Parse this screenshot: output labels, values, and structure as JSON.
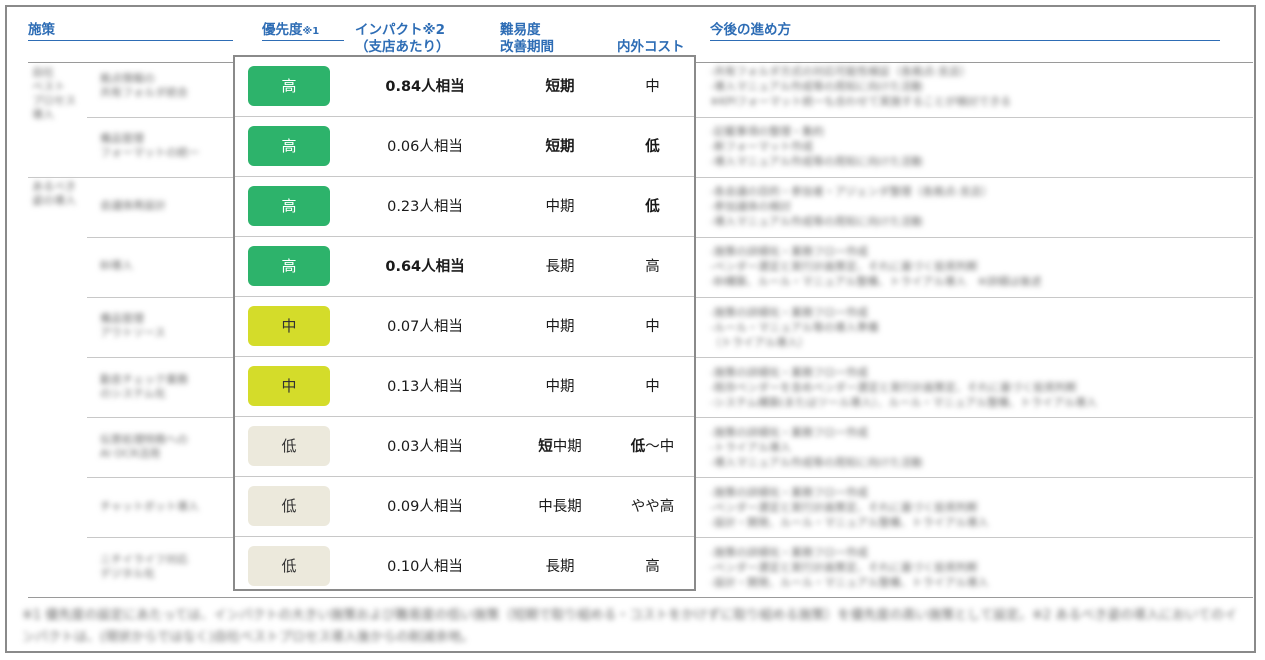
{
  "headers": {
    "measure": "施策",
    "priority": "優先度",
    "priority_note": "※1",
    "impact": "インパクト",
    "impact_note": "※2",
    "impact_sub": "（支店あたり）",
    "difficulty": "難易度",
    "period": "改善期間",
    "cost": "内外コスト",
    "next_steps": "今後の進め方"
  },
  "colors": {
    "header_blue": "#2e6db5",
    "high": "#2db36b",
    "mid": "#d4dc2a",
    "low": "#ece9dc"
  },
  "groups": [
    {
      "label": "自社\nベスト\nプロセス\n導入"
    },
    {
      "label": "あるべき\n姿の導入"
    }
  ],
  "rows": [
    {
      "name": "拠点情報の\n共有フォルダ統合",
      "priority": "高",
      "level": "high",
      "impact": "0.84人相当",
      "impact_bold": true,
      "period": "短期",
      "period_bold_part": "短期",
      "cost": "中",
      "cost_bold": false,
      "desc": "-共有フォルダ方式の対応可能性検証（各拠点-支店）\n-導入マニュアル作成等の周知に向けた活動\n※KPIフォーマット統一も合わせて実施することが検討できる"
    },
    {
      "name": "備品管理\nフォーマットの統一",
      "priority": "高",
      "level": "high",
      "impact": "0.06人相当",
      "impact_bold": false,
      "period": "短期",
      "period_bold_part": "短期",
      "cost": "低",
      "cost_bold": true,
      "desc": "-記載事項の整理・集約\n-新フォーマット作成\n-導入マニュアル作成等の周知に向けた活動"
    },
    {
      "name": "会議体再設計",
      "priority": "高",
      "level": "high",
      "impact": "0.23人相当",
      "impact_bold": false,
      "period": "中期",
      "period_bold_part": "",
      "cost": "低",
      "cost_bold": true,
      "desc": "-各会議の目的・参加者・アジェンダ整理（各拠点-支店）\n-参加議体の検討\n-導入マニュアル作成等の周知に向けた活動"
    },
    {
      "name": "BI導入",
      "priority": "高",
      "level": "high",
      "impact": "0.64人相当",
      "impact_bold": true,
      "period": "長期",
      "period_bold_part": "",
      "cost": "高",
      "cost_bold": false,
      "desc": "-施策の詳細化・業務フロー作成\n-ベンダー選定と実行計画策定、それに基づく投資判断\n-BI構築、ルール・マニュアル整備、トライアル導入　※詳細は後述"
    },
    {
      "name": "備品管理\nアウトソース",
      "priority": "中",
      "level": "mid",
      "impact": "0.07人相当",
      "impact_bold": false,
      "period": "中期",
      "period_bold_part": "",
      "cost": "中",
      "cost_bold": false,
      "desc": "-施策の詳細化・業務フロー作成\n-ルール・マニュアル等の導入準備\n（トライアル導入）"
    },
    {
      "name": "勤怠チェック業務\nのシステム化",
      "priority": "中",
      "level": "mid",
      "impact": "0.13人相当",
      "impact_bold": false,
      "period": "中期",
      "period_bold_part": "",
      "cost": "中",
      "cost_bold": false,
      "desc": "-施策の詳細化・業務フロー作成\n-既存ベンダーを含めベンダー選定と実行計画策定、それに基づく投資判断\n-システム構築(またはツール導入）、ルール・マニュアル整備、トライアル導入"
    },
    {
      "name": "伝票処理特務への\nAI OCR活用",
      "priority": "低",
      "level": "low",
      "impact": "0.03人相当",
      "impact_bold": false,
      "period": "短中期",
      "period_bold_part": "短",
      "cost": "低〜中",
      "cost_bold_part": "低",
      "desc": "-施策の詳細化・業務フロー作成\n-トライアル導入\n-導入マニュアル作成等の周知に向けた活動"
    },
    {
      "name": "チャットボット導入",
      "priority": "低",
      "level": "low",
      "impact": "0.09人相当",
      "impact_bold": false,
      "period": "中長期",
      "period_bold_part": "",
      "cost": "やや高",
      "cost_bold": false,
      "desc": "-施策の詳細化・業務フロー作成\n-ベンダー選定と実行計画策定、それに基づく投資判断\n-設計・開発、ルール・マニュアル整備、トライアル導入"
    },
    {
      "name": "ニチイライフ対応\nデジタル化",
      "priority": "低",
      "level": "low",
      "impact": "0.10人相当",
      "impact_bold": false,
      "period": "長期",
      "period_bold_part": "",
      "cost": "高",
      "cost_bold": false,
      "desc": "-施策の詳細化・業務フロー作成\n-ベンダー選定と実行計画策定、それに基づく投資判断\n-設計・開発、ルール・マニュアル整備、トライアル導入"
    }
  ],
  "footnote": "※1 優先度の設定にあたっては、インパクトの大きい施策および難易度の低い施策（短期で取り組める・コストをかけずに取り組める施策）を優先度の高い施策として設定。※2 あるべき姿の導入においてのインパクトは、(現状からではなく)自社ベストプロセス導入後からの削減余地。"
}
